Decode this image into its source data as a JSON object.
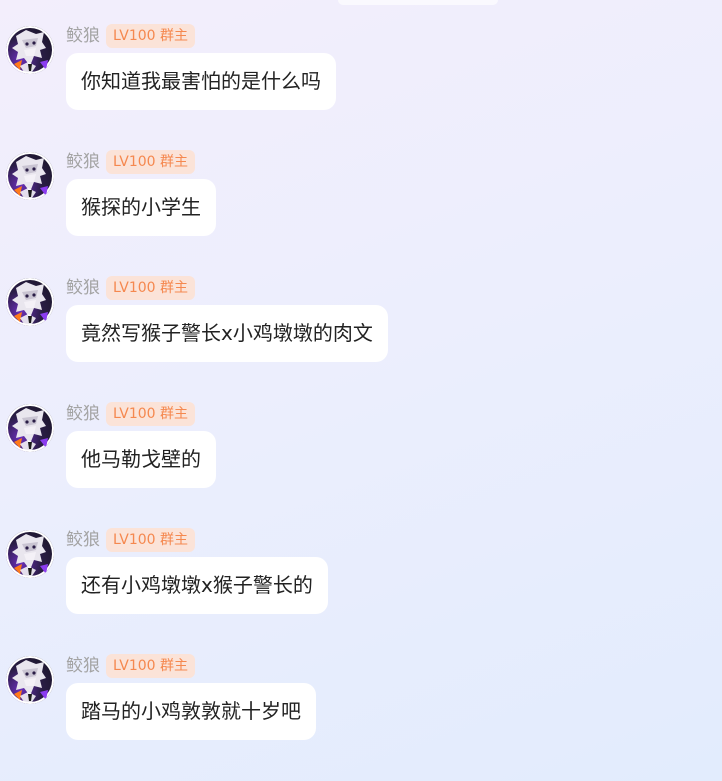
{
  "messages": [
    {
      "sender": "鲛狼",
      "badge": "LV100 群主",
      "text": "你知道我最害怕的是什么吗"
    },
    {
      "sender": "鲛狼",
      "badge": "LV100 群主",
      "text": "猴探的小学生"
    },
    {
      "sender": "鲛狼",
      "badge": "LV100 群主",
      "text": "竟然写猴子警长x小鸡墩墩的肉文"
    },
    {
      "sender": "鲛狼",
      "badge": "LV100 群主",
      "text": "他马勒戈壁的"
    },
    {
      "sender": "鲛狼",
      "badge": "LV100 群主",
      "text": "还有小鸡墩墩x猴子警长的"
    },
    {
      "sender": "鲛狼",
      "badge": "LV100 群主",
      "text": "踏马的小鸡敦敦就十岁吧"
    }
  ],
  "colors": {
    "badge_bg": "#fbe3d8",
    "badge_text": "#f5884f",
    "name_text": "#a3a3a3",
    "bubble_bg": "#ffffff"
  }
}
